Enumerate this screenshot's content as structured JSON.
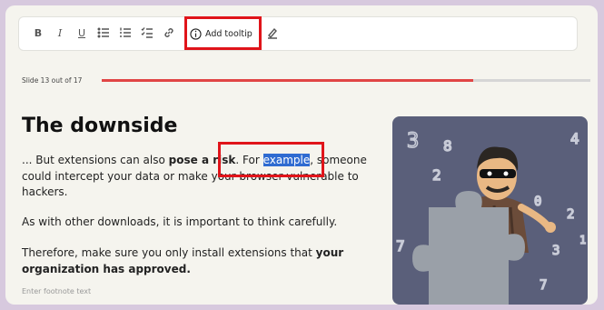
{
  "toolbar": {
    "bold_icon": "bold-icon",
    "italic_icon": "italic-icon",
    "underline_icon": "underline-icon",
    "bullet_list_icon": "bullet-list-icon",
    "numbered_list_icon": "numbered-list-icon",
    "checklist_icon": "checklist-icon",
    "link_icon": "link-icon",
    "tooltip_label": "Add tooltip",
    "tooltip_icon": "info-circle-icon",
    "highlighter_icon": "highlighter-icon"
  },
  "slide": {
    "counter": "Slide 13 out of 17",
    "progress": 0.76,
    "progress_color": "#e14545"
  },
  "content": {
    "title": "The downside",
    "para1_before": "... But extensions can also ",
    "para1_bold": "pose a risk",
    "para1_mid": ". For ",
    "para1_highlight": "example",
    "para1_after": ", someone could intercept your data or make your browser vulnerable to hackers.",
    "para2": "As with other downloads, it is important to think carefully.",
    "para3_before": "Therefore, make sure you only install extensions that ",
    "para3_bold": "your organization has approved."
  },
  "footnote_placeholder": "Enter footnote text",
  "illustration": {
    "digits": [
      "3",
      "8",
      "4",
      "2",
      "7",
      "0",
      "2",
      "3",
      "7",
      "1"
    ],
    "highlight_color": "#2f6bd1",
    "annotation_color": "#e0141a"
  }
}
